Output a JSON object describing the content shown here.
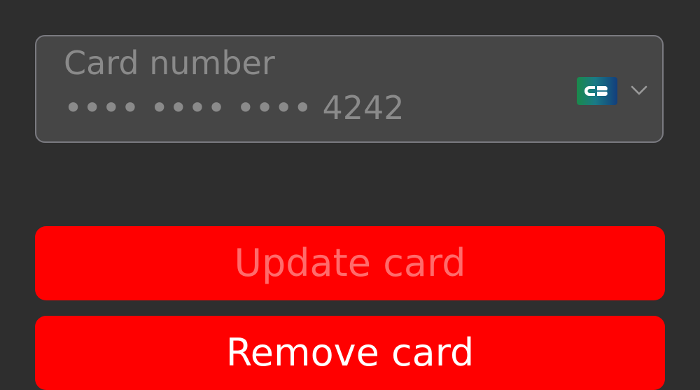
{
  "card_field": {
    "label": "Card number",
    "value": "•••• •••• •••• 4242",
    "brand_icon": "cb-card-brand-icon",
    "dropdown_icon": "chevron-down-icon"
  },
  "actions": {
    "update_label": "Update card",
    "remove_label": "Remove card"
  },
  "colors": {
    "background": "#2e2e2e",
    "field_background": "#464646",
    "field_border": "#7a7a80",
    "button_red": "#ff0000",
    "disabled_text": "#ff6b6b"
  }
}
